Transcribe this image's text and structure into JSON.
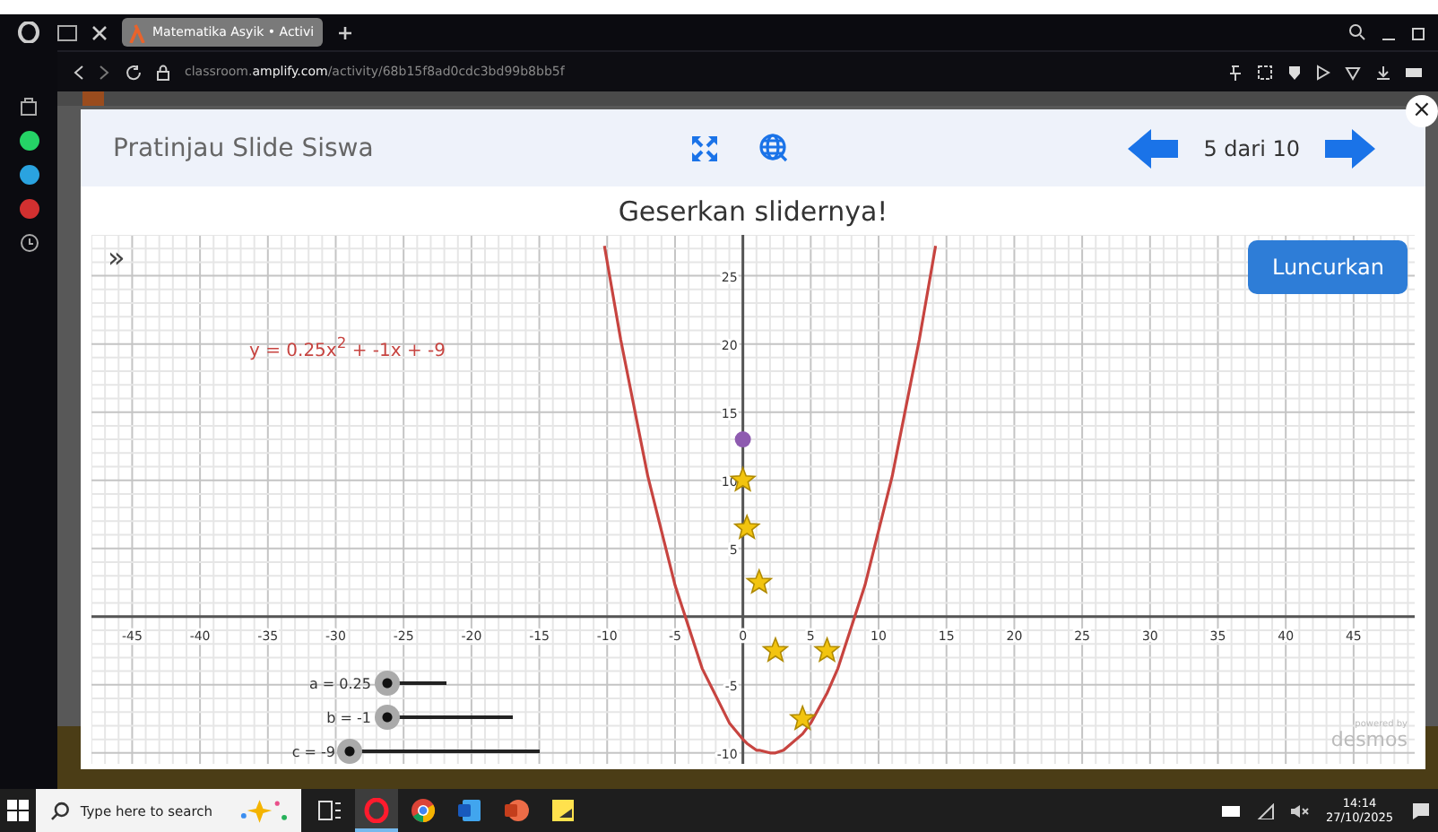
{
  "browser": {
    "tab": {
      "title": "Matematika Asyik • Activi",
      "selected": true
    },
    "url": "classroom.**amplify.com**/activity/68b15f8ad0cdc3bd99b8bb5f"
  },
  "modal": {
    "title": "Pratinjau Slide Siswa",
    "page": "5 dari 10",
    "close": "×",
    "heading": "Geserkan slidernya!",
    "collapse": "»",
    "launch_button": "Luncurkan",
    "graph": {
      "sliders": [
        {
          "label": "a = 0.25",
          "level": 0.03
        },
        {
          "label": "b = -1",
          "level": 0.02
        },
        {
          "label": "c = -9",
          "level": 0
        }
      ],
      "watermark": {
        "small": "powered by",
        "logo": "desmos"
      },
      "chart_data": {
        "type": "line",
        "grid": true,
        "xlim": [
          -48,
          49.5
        ],
        "ylim": [
          -10.8,
          28
        ],
        "xticks": [
          -45,
          -40,
          -35,
          -30,
          -25,
          -20,
          -15,
          -10,
          -5,
          0,
          5,
          10,
          15,
          20,
          25,
          30,
          35,
          40,
          45
        ],
        "yticks": [
          -10,
          -5,
          5,
          10,
          15,
          20,
          25
        ],
        "x": [
          -10.2,
          -9,
          -7,
          -5,
          -3,
          -1,
          0,
          0.3,
          1,
          1.2,
          2,
          2.4,
          3,
          4.4,
          5,
          6.2,
          7,
          9,
          11,
          13,
          14.2
        ],
        "series": [
          {
            "name": "y = 0.25x$^{2}$ + -1x + -9",
            "type": "line",
            "color": "#c74440",
            "values": [
              27.2,
              20.3,
              10.3,
              2.3,
              -3.8,
              -7.8,
              -9,
              -9.3,
              -9.8,
              -9.8,
              -10,
              -10,
              -9.8,
              -8.6,
              -7.8,
              -5.6,
              -3.8,
              2.3,
              10.3,
              20.3,
              27.2
            ]
          },
          {
            "type": "scatter",
            "color": "#f2c40f",
            "values": [
              null,
              null,
              null,
              null,
              null,
              null,
              10,
              6.5,
              null,
              2.5,
              null,
              -2.5,
              null,
              -7.5,
              null,
              -2.5,
              null,
              null,
              null,
              null,
              null
            ]
          },
          {
            "type": "scatter",
            "color": "#8e5bb0",
            "values": [
              null,
              null,
              null,
              null,
              null,
              null,
              13,
              null,
              null,
              null,
              null,
              null,
              null,
              null,
              null,
              null,
              null,
              null,
              null,
              null,
              null
            ]
          }
        ]
      }
    }
  },
  "taskbar": {
    "search_placeholder": "Type here to search",
    "apps": [
      {
        "kind": "taskview",
        "selected": false
      },
      {
        "kind": "opera",
        "selected": true
      },
      {
        "kind": "chrome",
        "selected": false
      },
      {
        "kind": "word",
        "selected": false
      },
      {
        "kind": "powerpoint",
        "selected": false
      },
      {
        "kind": "notes",
        "selected": false
      }
    ],
    "time": "14:14",
    "date": "27/10/2025"
  }
}
